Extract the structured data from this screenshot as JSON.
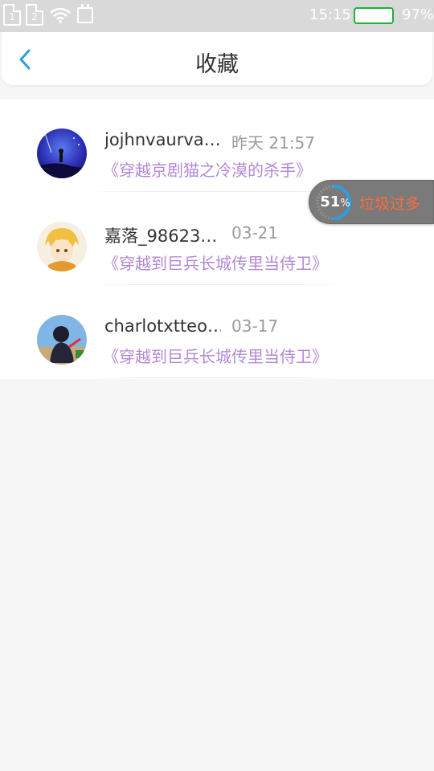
{
  "status_bar": {
    "sim1": "1",
    "sim2": "2",
    "time": "15:15",
    "battery": "97%",
    "battery_level": 0.97,
    "battery_color": "#1db03a"
  },
  "header": {
    "title": "收藏"
  },
  "favorites": [
    {
      "username": "jojhnvaurva…",
      "time": "昨天 21:57",
      "book": "《穿越京剧猫之冷漠的杀手》"
    },
    {
      "username": "嘉落_98623…",
      "time": "03-21",
      "book": "《穿越到巨兵长城传里当侍卫》"
    },
    {
      "username": "charlotxtteo…",
      "time": "03-17",
      "book": "《穿越到巨兵长城传里当侍卫》"
    }
  ],
  "widget": {
    "percent": "51",
    "percent_sign": "%",
    "label": "垃圾过多",
    "label_color": "#ff6a3c"
  },
  "colors": {
    "accent": "#2a9fe0",
    "book_title": "#b388d6"
  }
}
